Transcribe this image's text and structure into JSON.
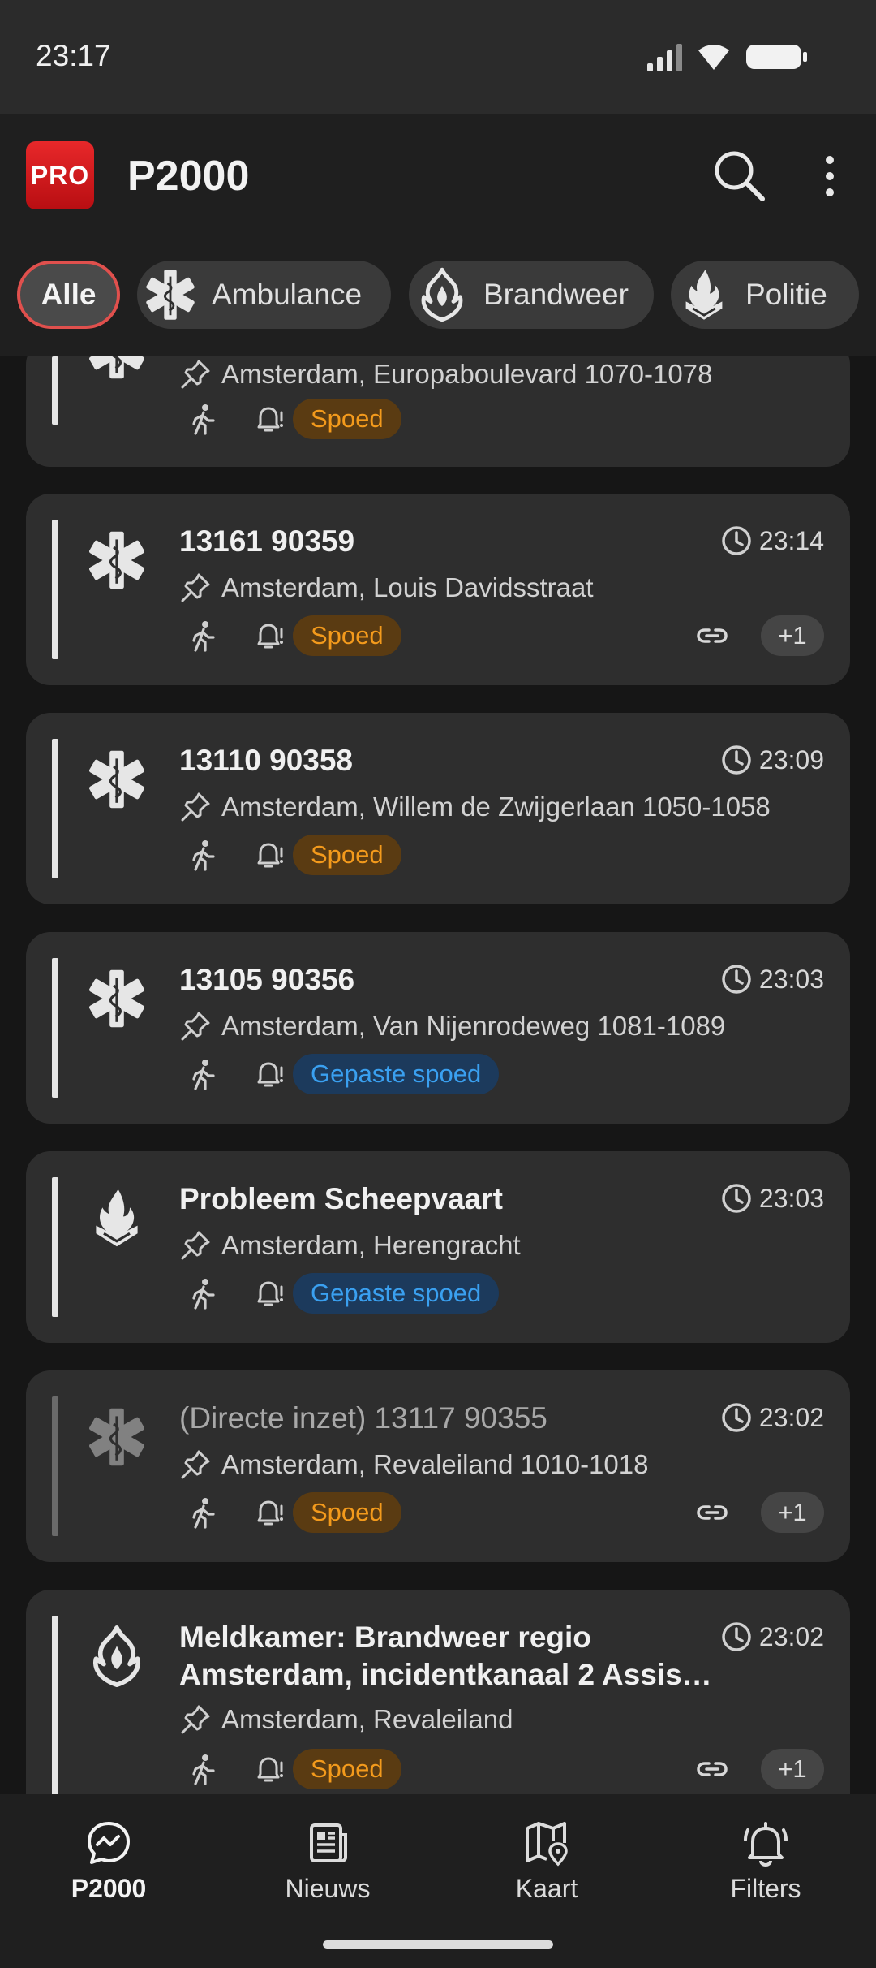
{
  "status": {
    "time": "23:17"
  },
  "app": {
    "logo": "PRO",
    "title": "P2000"
  },
  "filters": [
    {
      "label": "Alle",
      "icon": "",
      "active": true
    },
    {
      "label": "Ambulance",
      "icon": "star-of-life-icon"
    },
    {
      "label": "Brandweer",
      "icon": "fire-department-icon"
    },
    {
      "label": "Politie",
      "icon": "police-icon"
    }
  ],
  "alerts": [
    {
      "title": "",
      "time": "",
      "address": "Amsterdam, Europaboulevard 1070-1078",
      "priority": "Spoed",
      "icon": "star-of-life-icon"
    },
    {
      "title": "13161 90359",
      "time": "23:14",
      "address": "Amsterdam, Louis Davidsstraat",
      "priority": "Spoed",
      "extra": "+1",
      "icon": "star-of-life-icon"
    },
    {
      "title": "13110 90358",
      "time": "23:09",
      "address": "Amsterdam, Willem de Zwijgerlaan 1050-1058",
      "priority": "Spoed",
      "icon": "star-of-life-icon"
    },
    {
      "title": "13105 90356",
      "time": "23:03",
      "address": "Amsterdam, Van Nijenrodeweg 1081-1089",
      "priority": "Gepaste spoed",
      "icon": "star-of-life-icon"
    },
    {
      "title": "Probleem Scheepvaart",
      "time": "23:03",
      "address": "Amsterdam, Herengracht",
      "priority": "Gepaste spoed",
      "icon": "police-icon"
    },
    {
      "title": "(Directe inzet) 13117 90355",
      "time": "23:02",
      "address": "Amsterdam, Revaleiland 1010-1018",
      "priority": "Spoed",
      "extra": "+1",
      "icon": "star-of-life-icon"
    },
    {
      "title": "Meldkamer: Brandweer regio Amsterdam, incidentkanaal 2 Assis…",
      "time": "23:02",
      "address": "Amsterdam, Revaleiland",
      "priority": "Spoed",
      "extra": "+1",
      "icon": "fire-department-icon"
    }
  ],
  "nav": [
    {
      "label": "P2000",
      "icon": "chat-pulse-icon",
      "active": true
    },
    {
      "label": "Nieuws",
      "icon": "news-icon"
    },
    {
      "label": "Kaart",
      "icon": "map-icon"
    },
    {
      "label": "Filters",
      "icon": "bell-icon"
    }
  ],
  "colors": {
    "spoed": "#f39a1c",
    "gepaste_spoed": "#3aa0f0",
    "active_filter_border": "#e0504d",
    "logo_red": "#d41a1e"
  }
}
